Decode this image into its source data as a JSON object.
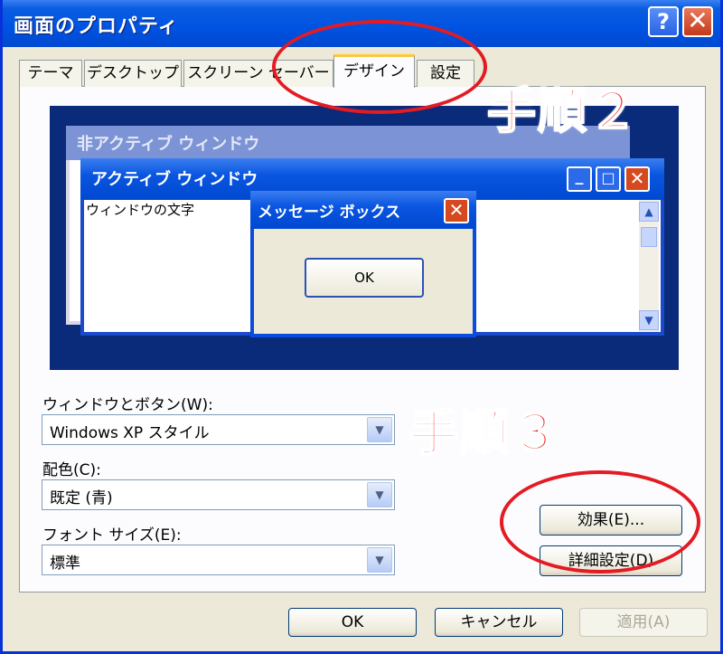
{
  "window": {
    "title": "画面のプロパティ",
    "help_glyph": "?",
    "close_glyph": "✕"
  },
  "tabs": [
    {
      "label": "テーマ"
    },
    {
      "label": "デスクトップ"
    },
    {
      "label": "スクリーン セーバー"
    },
    {
      "label": "デザイン",
      "active": true
    },
    {
      "label": "設定"
    }
  ],
  "preview": {
    "inactive_title": "非アクティブ ウィンドウ",
    "active_title": "アクティブ ウィンドウ",
    "window_text": "ウィンドウの文字",
    "message_title": "メッセージ ボックス",
    "message_ok": "OK"
  },
  "form": {
    "window_buttons": {
      "label": "ウィンドウとボタン(W):",
      "value": "Windows XP スタイル"
    },
    "color_scheme": {
      "label": "配色(C):",
      "value": "既定 (青)"
    },
    "font_size": {
      "label": "フォント サイズ(E):",
      "value": "標準"
    }
  },
  "buttons": {
    "effects": "効果(E)...",
    "advanced": "詳細設定(D)"
  },
  "footer": {
    "ok": "OK",
    "cancel": "キャンセル",
    "apply": "適用(A)"
  },
  "annotations": {
    "step2": "手順２",
    "step3": "手順３"
  },
  "colors": {
    "titlebar": "#0054e3",
    "dialog_bg": "#ece9d8",
    "annotation": "#ec2b24",
    "preview_bg": "#0a2a7a"
  }
}
